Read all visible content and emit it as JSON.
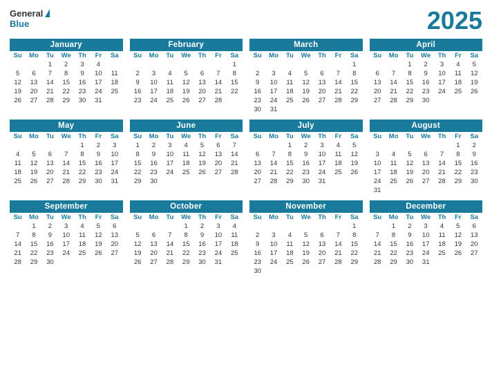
{
  "year": "2025",
  "logo": {
    "general": "General",
    "blue": "Blue"
  },
  "months": [
    {
      "name": "January",
      "days": [
        [
          "",
          "",
          "1",
          "2",
          "3",
          "4"
        ],
        [
          "5",
          "6",
          "7",
          "8",
          "9",
          "10",
          "11"
        ],
        [
          "12",
          "13",
          "14",
          "15",
          "16",
          "17",
          "18"
        ],
        [
          "19",
          "20",
          "21",
          "22",
          "23",
          "24",
          "25"
        ],
        [
          "26",
          "27",
          "28",
          "29",
          "30",
          "31",
          ""
        ]
      ]
    },
    {
      "name": "February",
      "days": [
        [
          "",
          "",
          "",
          "",
          "",
          "",
          "1"
        ],
        [
          "2",
          "3",
          "4",
          "5",
          "6",
          "7",
          "8"
        ],
        [
          "9",
          "10",
          "11",
          "12",
          "13",
          "14",
          "15"
        ],
        [
          "16",
          "17",
          "18",
          "19",
          "20",
          "21",
          "22"
        ],
        [
          "23",
          "24",
          "25",
          "26",
          "27",
          "28",
          ""
        ]
      ]
    },
    {
      "name": "March",
      "days": [
        [
          "",
          "",
          "",
          "",
          "",
          "",
          "1"
        ],
        [
          "2",
          "3",
          "4",
          "5",
          "6",
          "7",
          "8"
        ],
        [
          "9",
          "10",
          "11",
          "12",
          "13",
          "14",
          "15"
        ],
        [
          "16",
          "17",
          "18",
          "19",
          "20",
          "21",
          "22"
        ],
        [
          "23",
          "24",
          "25",
          "26",
          "27",
          "28",
          "29"
        ],
        [
          "30",
          "31",
          "",
          "",
          "",
          "",
          ""
        ]
      ]
    },
    {
      "name": "April",
      "days": [
        [
          "",
          "",
          "1",
          "2",
          "3",
          "4",
          "5"
        ],
        [
          "6",
          "7",
          "8",
          "9",
          "10",
          "11",
          "12"
        ],
        [
          "13",
          "14",
          "15",
          "16",
          "17",
          "18",
          "19"
        ],
        [
          "20",
          "21",
          "22",
          "23",
          "24",
          "25",
          "26"
        ],
        [
          "27",
          "28",
          "29",
          "30",
          "",
          "",
          ""
        ]
      ]
    },
    {
      "name": "May",
      "days": [
        [
          "",
          "",
          "",
          "",
          "1",
          "2",
          "3"
        ],
        [
          "4",
          "5",
          "6",
          "7",
          "8",
          "9",
          "10"
        ],
        [
          "11",
          "12",
          "13",
          "14",
          "15",
          "16",
          "17"
        ],
        [
          "18",
          "19",
          "20",
          "21",
          "22",
          "23",
          "24"
        ],
        [
          "25",
          "26",
          "27",
          "28",
          "29",
          "30",
          "31"
        ]
      ]
    },
    {
      "name": "June",
      "days": [
        [
          "1",
          "2",
          "3",
          "4",
          "5",
          "6",
          "7"
        ],
        [
          "8",
          "9",
          "10",
          "11",
          "12",
          "13",
          "14"
        ],
        [
          "15",
          "16",
          "17",
          "18",
          "19",
          "20",
          "21"
        ],
        [
          "22",
          "23",
          "24",
          "25",
          "26",
          "27",
          "28"
        ],
        [
          "29",
          "30",
          "",
          "",
          "",
          "",
          ""
        ]
      ]
    },
    {
      "name": "July",
      "days": [
        [
          "",
          "",
          "1",
          "2",
          "3",
          "4",
          "5"
        ],
        [
          "6",
          "7",
          "8",
          "9",
          "10",
          "11",
          "12"
        ],
        [
          "13",
          "14",
          "15",
          "16",
          "17",
          "18",
          "19"
        ],
        [
          "20",
          "21",
          "22",
          "23",
          "24",
          "25",
          "26"
        ],
        [
          "27",
          "28",
          "29",
          "30",
          "31",
          "",
          ""
        ]
      ]
    },
    {
      "name": "August",
      "days": [
        [
          "",
          "",
          "",
          "",
          "",
          "1",
          "2"
        ],
        [
          "3",
          "4",
          "5",
          "6",
          "7",
          "8",
          "9"
        ],
        [
          "10",
          "11",
          "12",
          "13",
          "14",
          "15",
          "16"
        ],
        [
          "17",
          "18",
          "19",
          "20",
          "21",
          "22",
          "23"
        ],
        [
          "24",
          "25",
          "26",
          "27",
          "28",
          "29",
          "30"
        ],
        [
          "31",
          "",
          "",
          "",
          "",
          "",
          ""
        ]
      ]
    },
    {
      "name": "September",
      "days": [
        [
          "",
          "1",
          "2",
          "3",
          "4",
          "5",
          "6"
        ],
        [
          "7",
          "8",
          "9",
          "10",
          "11",
          "12",
          "13"
        ],
        [
          "14",
          "15",
          "16",
          "17",
          "18",
          "19",
          "20"
        ],
        [
          "21",
          "22",
          "23",
          "24",
          "25",
          "26",
          "27"
        ],
        [
          "28",
          "29",
          "30",
          "",
          "",
          "",
          ""
        ]
      ]
    },
    {
      "name": "October",
      "days": [
        [
          "",
          "",
          "",
          "1",
          "2",
          "3",
          "4"
        ],
        [
          "5",
          "6",
          "7",
          "8",
          "9",
          "10",
          "11"
        ],
        [
          "12",
          "13",
          "14",
          "15",
          "16",
          "17",
          "18"
        ],
        [
          "19",
          "20",
          "21",
          "22",
          "23",
          "24",
          "25"
        ],
        [
          "26",
          "27",
          "28",
          "29",
          "30",
          "31",
          ""
        ]
      ]
    },
    {
      "name": "November",
      "days": [
        [
          "",
          "",
          "",
          "",
          "",
          "",
          "1"
        ],
        [
          "2",
          "3",
          "4",
          "5",
          "6",
          "7",
          "8"
        ],
        [
          "9",
          "10",
          "11",
          "12",
          "13",
          "14",
          "15"
        ],
        [
          "16",
          "17",
          "18",
          "19",
          "20",
          "21",
          "22"
        ],
        [
          "23",
          "24",
          "25",
          "26",
          "27",
          "28",
          "29"
        ],
        [
          "30",
          "",
          "",
          "",
          "",
          "",
          ""
        ]
      ]
    },
    {
      "name": "December",
      "days": [
        [
          "",
          "1",
          "2",
          "3",
          "4",
          "5",
          "6"
        ],
        [
          "7",
          "8",
          "9",
          "10",
          "11",
          "12",
          "13"
        ],
        [
          "14",
          "15",
          "16",
          "17",
          "18",
          "19",
          "20"
        ],
        [
          "21",
          "22",
          "23",
          "24",
          "25",
          "26",
          "27"
        ],
        [
          "28",
          "29",
          "30",
          "31",
          "",
          "",
          ""
        ]
      ]
    }
  ],
  "weekdays": [
    "Su",
    "Mo",
    "Tu",
    "We",
    "Th",
    "Fr",
    "Sa"
  ]
}
